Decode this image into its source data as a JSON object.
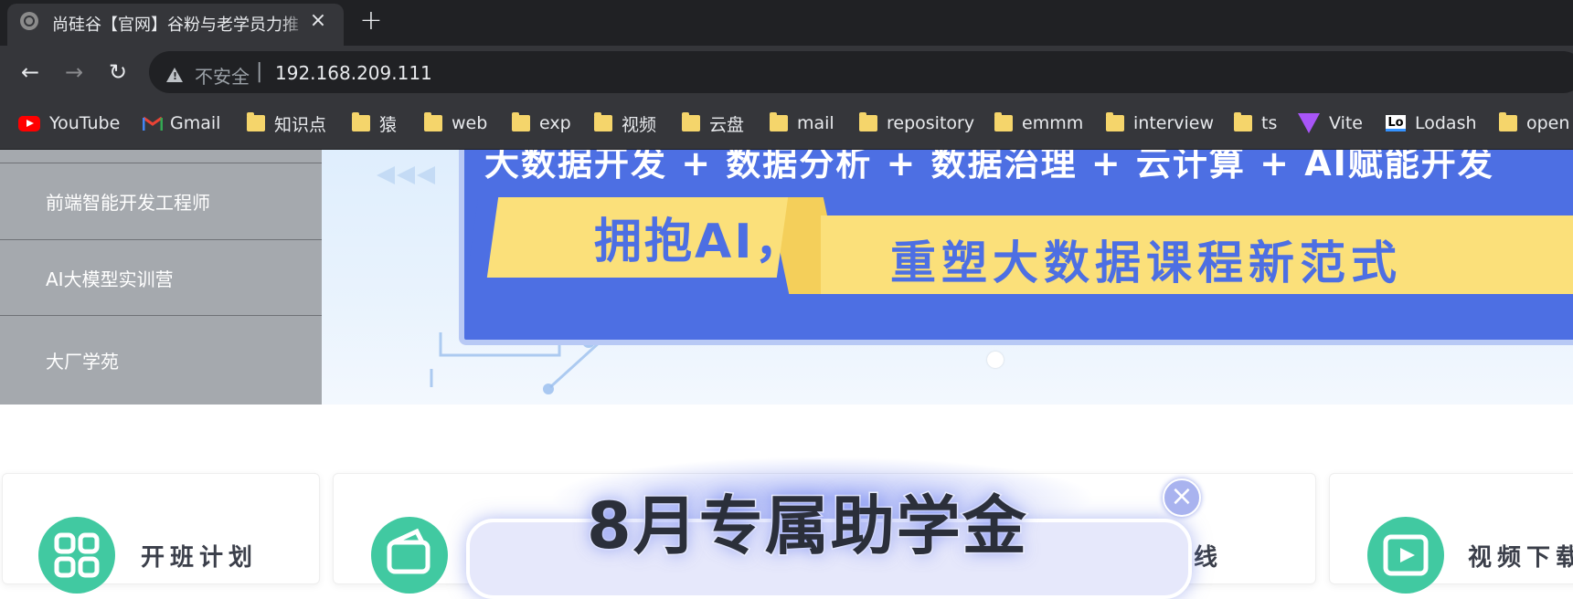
{
  "browser": {
    "tab": {
      "title": "尚硅谷【官网】谷粉与老学员力推"
    },
    "toolbar": {
      "security_label": "不安全",
      "separator": "|",
      "url": "192.168.209.111"
    },
    "bookmarks": [
      {
        "label": "YouTube",
        "icon": "youtube-icon"
      },
      {
        "label": "Gmail",
        "icon": "gmail-icon"
      },
      {
        "label": "知识点",
        "icon": "folder-icon"
      },
      {
        "label": "猿",
        "icon": "folder-icon"
      },
      {
        "label": "web",
        "icon": "folder-icon"
      },
      {
        "label": "exp",
        "icon": "folder-icon"
      },
      {
        "label": "视频",
        "icon": "folder-icon"
      },
      {
        "label": "云盘",
        "icon": "folder-icon"
      },
      {
        "label": "mail",
        "icon": "folder-icon"
      },
      {
        "label": "repository",
        "icon": "folder-icon"
      },
      {
        "label": "emmm",
        "icon": "folder-icon"
      },
      {
        "label": "interview",
        "icon": "folder-icon"
      },
      {
        "label": "ts",
        "icon": "folder-icon"
      },
      {
        "label": "Vite",
        "icon": "vite-icon"
      },
      {
        "label": "Lodash",
        "icon": "lodash-icon"
      },
      {
        "label": "open",
        "icon": "folder-icon"
      }
    ]
  },
  "sidenav": {
    "items": [
      {
        "label": "前端智能开发工程师"
      },
      {
        "label": "AI大模型实训营"
      },
      {
        "label": "大厂学苑"
      }
    ]
  },
  "banner": {
    "headline": "大数据开发 + 数据分析 + 数据治理 + 云计算 + AI赋能开发",
    "tag": "拥抱AI，",
    "slogan": "重塑大数据课程新范式"
  },
  "cards": [
    {
      "title": "开班计划",
      "icon": "grid-icon"
    },
    {
      "title": "",
      "icon": "wallet-icon"
    },
    {
      "title": "学习路线",
      "icon": "route-icon"
    },
    {
      "title": "视频下载",
      "icon": "video-icon"
    }
  ],
  "popup": {
    "title": "8月专属助学金",
    "close_glyph": "×"
  },
  "colors": {
    "chrome_dark": "#202124",
    "chrome_toolbar": "#35363a",
    "sidenav": "#a5a9ae",
    "banner_blue": "#4d6fe3",
    "banner_yellow": "#fbe07a",
    "card_icon": "#41c9a1"
  }
}
